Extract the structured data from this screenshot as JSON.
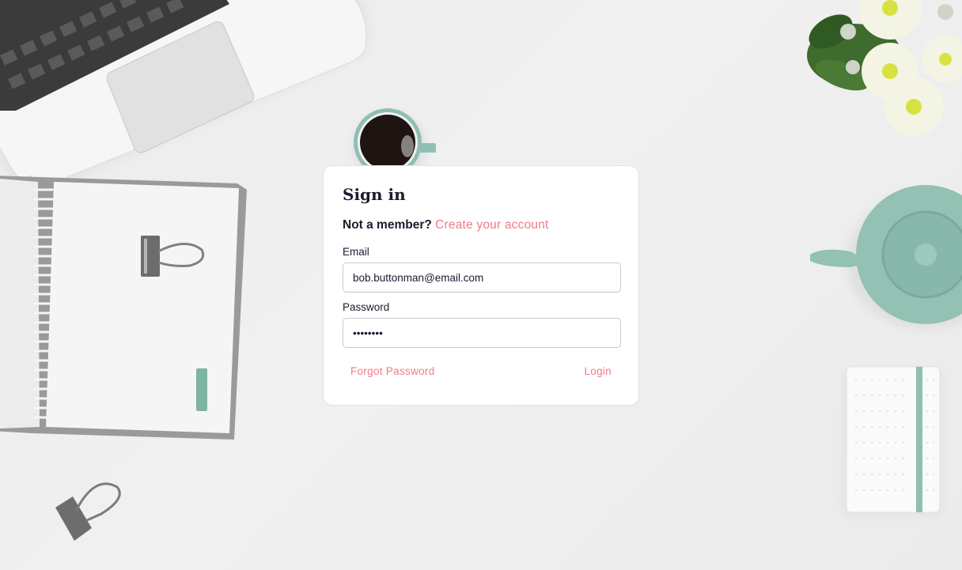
{
  "signin": {
    "title": "Sign in",
    "member_prompt": "Not a member?",
    "create_account_link": "Create your account",
    "email_label": "Email",
    "email_value": "bob.buttonman@email.com",
    "password_label": "Password",
    "password_value": "bobbutto",
    "forgot_password_label": "Forgot Password",
    "login_label": "Login"
  },
  "colors": {
    "accent": "#f07b86",
    "text": "#1b1b2e",
    "background": "#ececec",
    "mint": "#8fbfb2"
  }
}
